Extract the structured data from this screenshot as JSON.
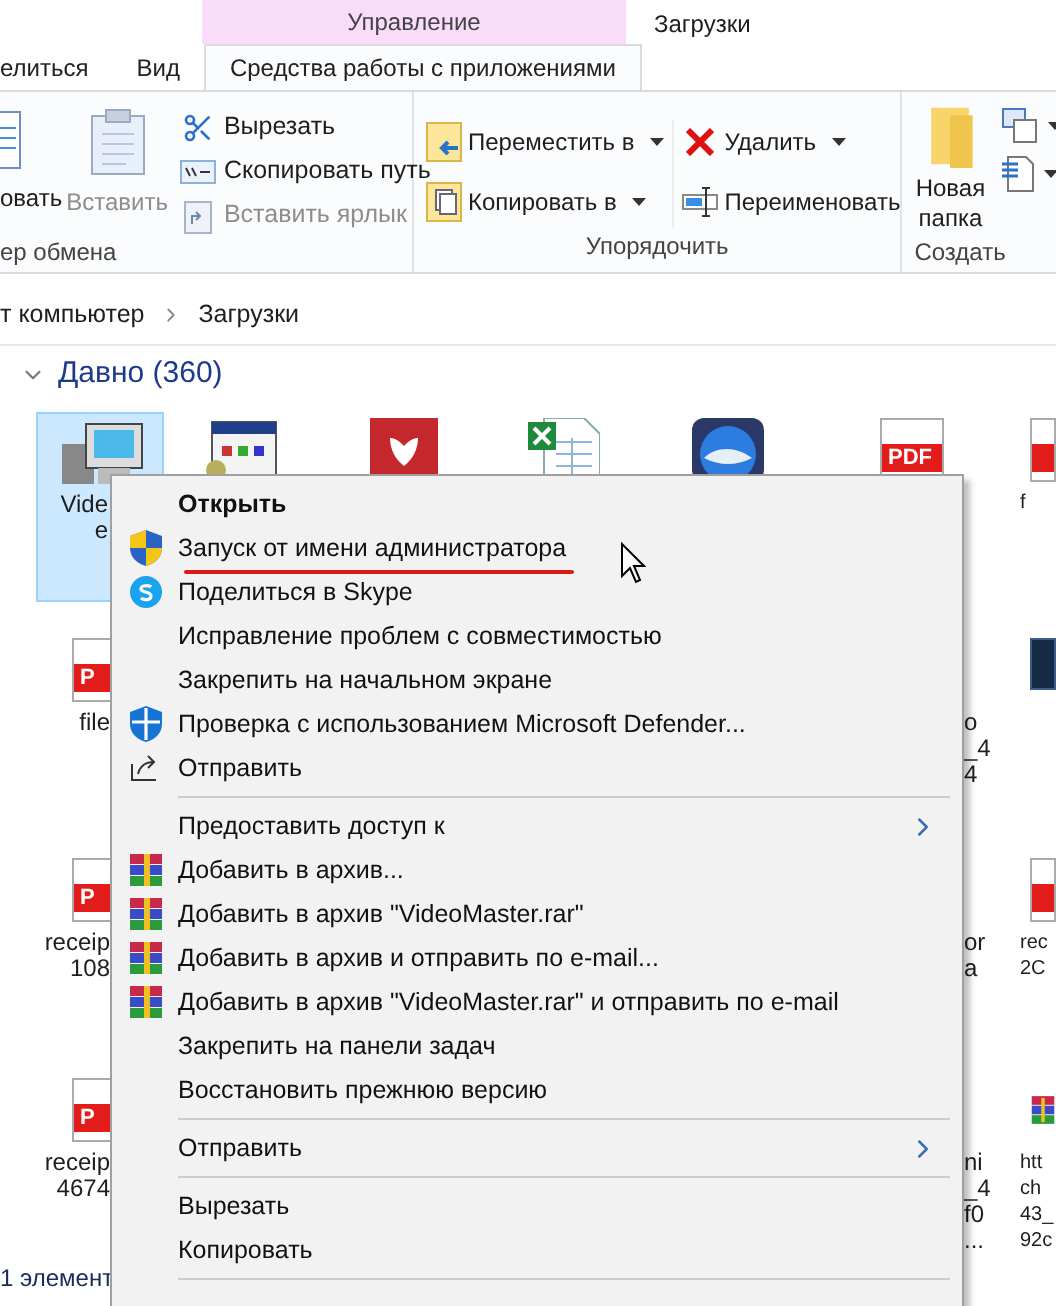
{
  "window": {
    "title": "Загрузки"
  },
  "ribbon": {
    "context_group": "Управление",
    "tabs": [
      {
        "label": "елиться",
        "selected": false
      },
      {
        "label": "Вид",
        "selected": false
      },
      {
        "label": "Средства работы с приложениями",
        "selected": true
      }
    ],
    "clipboard": {
      "label": "ер обмена",
      "large": [
        {
          "label": "овать",
          "kind": "copy",
          "disabled": false
        },
        {
          "label": "Вставить",
          "kind": "paste",
          "disabled": true
        }
      ],
      "small": [
        {
          "label": "Вырезать",
          "kind": "cut",
          "disabled": false
        },
        {
          "label": "Скопировать путь",
          "kind": "copy-path",
          "disabled": false
        },
        {
          "label": "Вставить ярлык",
          "kind": "paste-shortcut",
          "disabled": true
        }
      ]
    },
    "organize": {
      "label": "Упорядочить",
      "buttons": [
        {
          "label": "Переместить в",
          "kind": "move",
          "dropdown": true
        },
        {
          "label": "Копировать в",
          "kind": "copy-to",
          "dropdown": true
        },
        {
          "label": "Удалить",
          "kind": "delete",
          "dropdown": true
        },
        {
          "label": "Переименовать",
          "kind": "rename",
          "dropdown": false
        }
      ]
    },
    "create": {
      "label": "Создать",
      "large": {
        "label": "Новая папка"
      },
      "small": [
        {
          "kind": "new-item",
          "dropdown": true
        },
        {
          "kind": "easy-access",
          "dropdown": true
        }
      ]
    }
  },
  "address": {
    "path": [
      {
        "label": "т компьютер"
      },
      {
        "label": "Загрузки"
      }
    ]
  },
  "section": {
    "title": "Давно (360)",
    "expanded": true
  },
  "files": [
    {
      "column_1": {
        "kind": "program",
        "selected": true,
        "lines": [
          "Vide",
          "e"
        ]
      },
      "column_2": {
        "kind": "installer",
        "selected": false
      },
      "column_3": {
        "kind": "shield-app",
        "selected": false
      },
      "column_4": {
        "kind": "spreadsheet",
        "selected": false
      },
      "column_5": {
        "kind": "mail-app",
        "selected": false
      },
      "column_6": {
        "kind": "pdf",
        "selected": false,
        "badge": "PDF"
      },
      "column_7": {
        "kind": "pdf",
        "selected": false,
        "lines": [
          "f"
        ]
      }
    },
    {
      "column_1": {
        "kind": "pdf",
        "selected": false,
        "badge": "P",
        "lines": [
          "file"
        ]
      },
      "column_6": {
        "lines": [
          "o",
          "_4",
          "4"
        ]
      },
      "column_7": {
        "kind": "image",
        "selected": false
      }
    },
    {
      "column_1": {
        "kind": "pdf",
        "selected": false,
        "badge": "P",
        "lines": [
          "receip",
          "108"
        ]
      },
      "column_6": {
        "lines": [
          "or",
          "a"
        ]
      },
      "column_7": {
        "kind": "pdf",
        "selected": false,
        "lines": [
          "rec",
          "2C"
        ]
      }
    },
    {
      "column_1": {
        "kind": "pdf",
        "selected": false,
        "badge": "P",
        "lines": [
          "receip",
          "4674"
        ]
      },
      "column_6": {
        "lines": [
          "ni",
          "_4",
          "f0",
          "..."
        ]
      },
      "column_7": {
        "kind": "archive",
        "selected": false,
        "lines": [
          "htt",
          "ch",
          "43_",
          "92c"
        ]
      }
    }
  ],
  "context_menu": [
    {
      "kind": "item",
      "label": "Открыть",
      "default": true
    },
    {
      "kind": "admin",
      "label": "Запуск от имени администратора",
      "underlined": true
    },
    {
      "kind": "skype",
      "label": "Поделиться в Skype"
    },
    {
      "kind": "item",
      "label": "Исправление проблем с совместимостью"
    },
    {
      "kind": "item",
      "label": "Закрепить на начальном экране"
    },
    {
      "kind": "defender",
      "label": "Проверка с использованием Microsoft Defender..."
    },
    {
      "kind": "share",
      "label": "Отправить"
    },
    {
      "kind": "separator"
    },
    {
      "kind": "submenu",
      "label": "Предоставить доступ к"
    },
    {
      "kind": "archive",
      "label": "Добавить в архив..."
    },
    {
      "kind": "archive",
      "label": "Добавить в архив \"VideoMaster.rar\""
    },
    {
      "kind": "archive",
      "label": "Добавить в архив и отправить по e-mail..."
    },
    {
      "kind": "archive",
      "label": "Добавить в архив \"VideoMaster.rar\" и отправить по e-mail"
    },
    {
      "kind": "item",
      "label": "Закрепить на панели задач"
    },
    {
      "kind": "item",
      "label": "Восстановить прежнюю версию"
    },
    {
      "kind": "separator"
    },
    {
      "kind": "submenu",
      "label": "Отправить"
    },
    {
      "kind": "separator"
    },
    {
      "kind": "item",
      "label": "Вырезать"
    },
    {
      "kind": "item",
      "label": "Копировать"
    },
    {
      "kind": "separator"
    }
  ],
  "status_bar": {
    "text": "1 элемент"
  }
}
